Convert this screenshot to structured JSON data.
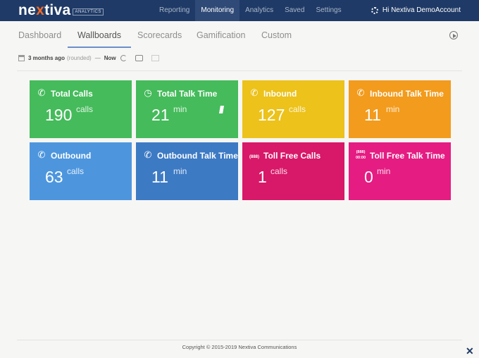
{
  "brand": {
    "name_pre": "ne",
    "name_x": "x",
    "name_post": "tiva",
    "badge": "ANALYTICS"
  },
  "nav": {
    "items": [
      {
        "label": "Reporting"
      },
      {
        "label": "Monitoring"
      },
      {
        "label": "Analytics"
      },
      {
        "label": "Saved"
      },
      {
        "label": "Settings"
      }
    ],
    "active": "Monitoring"
  },
  "account": {
    "greeting": "Hi Nextiva DemoAccount",
    "icon": "gear-icon"
  },
  "tabs": {
    "items": [
      {
        "label": "Dashboard"
      },
      {
        "label": "Wallboards"
      },
      {
        "label": "Scorecards"
      },
      {
        "label": "Gamification"
      },
      {
        "label": "Custom"
      }
    ],
    "active": "Wallboards"
  },
  "time_filter": {
    "range": "3 months ago",
    "qualifier": "(rounded)",
    "separator": "—",
    "end": "Now"
  },
  "tiles": [
    {
      "title": "Total Calls",
      "value": "190",
      "unit": "calls",
      "color": "#45bb5b",
      "icon": "phone-icon"
    },
    {
      "title": "Total Talk Time",
      "value": "21",
      "unit": "min",
      "color": "#45bb5b",
      "icon": "phone-timer-icon"
    },
    {
      "title": "Inbound",
      "value": "127",
      "unit": "calls",
      "color": "#ecc21b",
      "icon": "inbound-phone-icon"
    },
    {
      "title": "Inbound Talk Time",
      "value": "11",
      "unit": "min",
      "color": "#f29b1d",
      "icon": "inbound-timer-icon"
    },
    {
      "title": "Outbound",
      "value": "63",
      "unit": "calls",
      "color": "#4d96de",
      "icon": "outbound-phone-icon"
    },
    {
      "title": "Outbound Talk Time",
      "value": "11",
      "unit": "min",
      "color": "#3d7ac4",
      "icon": "outbound-timer-icon"
    },
    {
      "title": "Toll Free Calls",
      "value": "1",
      "unit": "calls",
      "color": "#d81868",
      "icon": "toll-free-icon",
      "icon_text": "(888)"
    },
    {
      "title": "Toll Free Talk Time",
      "value": "0",
      "unit": "min",
      "color": "#e51c82",
      "icon": "toll-free-timer-icon",
      "icon_text": "(888) 00:00"
    }
  ],
  "footer": {
    "copyright": "Copyright © 2015-2019 Nextiva Communications"
  }
}
